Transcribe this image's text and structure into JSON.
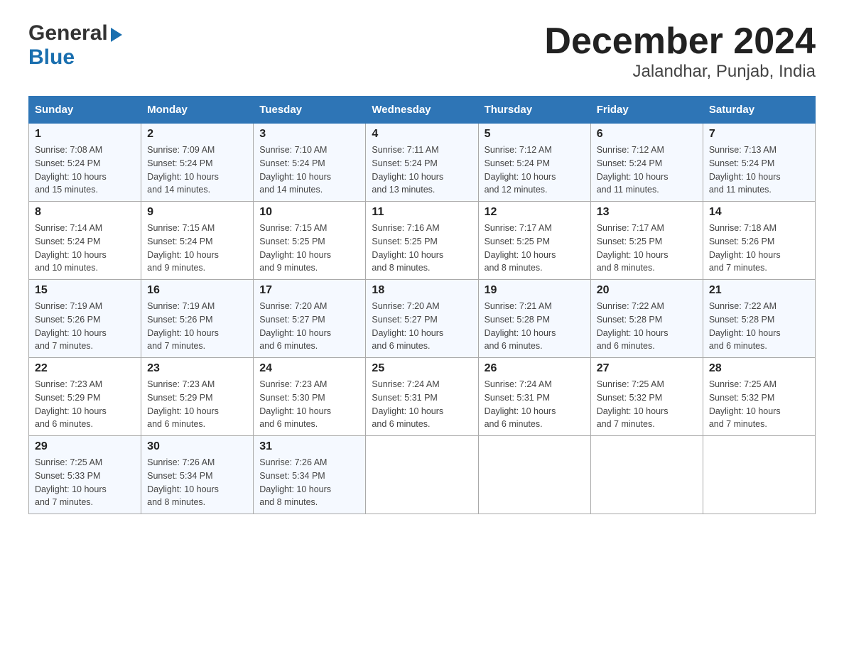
{
  "header": {
    "logo_general": "General",
    "logo_blue": "Blue",
    "title": "December 2024",
    "subtitle": "Jalandhar, Punjab, India"
  },
  "days_of_week": [
    "Sunday",
    "Monday",
    "Tuesday",
    "Wednesday",
    "Thursday",
    "Friday",
    "Saturday"
  ],
  "weeks": [
    [
      {
        "day": "1",
        "sunrise": "7:08 AM",
        "sunset": "5:24 PM",
        "daylight": "10 hours and 15 minutes."
      },
      {
        "day": "2",
        "sunrise": "7:09 AM",
        "sunset": "5:24 PM",
        "daylight": "10 hours and 14 minutes."
      },
      {
        "day": "3",
        "sunrise": "7:10 AM",
        "sunset": "5:24 PM",
        "daylight": "10 hours and 14 minutes."
      },
      {
        "day": "4",
        "sunrise": "7:11 AM",
        "sunset": "5:24 PM",
        "daylight": "10 hours and 13 minutes."
      },
      {
        "day": "5",
        "sunrise": "7:12 AM",
        "sunset": "5:24 PM",
        "daylight": "10 hours and 12 minutes."
      },
      {
        "day": "6",
        "sunrise": "7:12 AM",
        "sunset": "5:24 PM",
        "daylight": "10 hours and 11 minutes."
      },
      {
        "day": "7",
        "sunrise": "7:13 AM",
        "sunset": "5:24 PM",
        "daylight": "10 hours and 11 minutes."
      }
    ],
    [
      {
        "day": "8",
        "sunrise": "7:14 AM",
        "sunset": "5:24 PM",
        "daylight": "10 hours and 10 minutes."
      },
      {
        "day": "9",
        "sunrise": "7:15 AM",
        "sunset": "5:24 PM",
        "daylight": "10 hours and 9 minutes."
      },
      {
        "day": "10",
        "sunrise": "7:15 AM",
        "sunset": "5:25 PM",
        "daylight": "10 hours and 9 minutes."
      },
      {
        "day": "11",
        "sunrise": "7:16 AM",
        "sunset": "5:25 PM",
        "daylight": "10 hours and 8 minutes."
      },
      {
        "day": "12",
        "sunrise": "7:17 AM",
        "sunset": "5:25 PM",
        "daylight": "10 hours and 8 minutes."
      },
      {
        "day": "13",
        "sunrise": "7:17 AM",
        "sunset": "5:25 PM",
        "daylight": "10 hours and 8 minutes."
      },
      {
        "day": "14",
        "sunrise": "7:18 AM",
        "sunset": "5:26 PM",
        "daylight": "10 hours and 7 minutes."
      }
    ],
    [
      {
        "day": "15",
        "sunrise": "7:19 AM",
        "sunset": "5:26 PM",
        "daylight": "10 hours and 7 minutes."
      },
      {
        "day": "16",
        "sunrise": "7:19 AM",
        "sunset": "5:26 PM",
        "daylight": "10 hours and 7 minutes."
      },
      {
        "day": "17",
        "sunrise": "7:20 AM",
        "sunset": "5:27 PM",
        "daylight": "10 hours and 6 minutes."
      },
      {
        "day": "18",
        "sunrise": "7:20 AM",
        "sunset": "5:27 PM",
        "daylight": "10 hours and 6 minutes."
      },
      {
        "day": "19",
        "sunrise": "7:21 AM",
        "sunset": "5:28 PM",
        "daylight": "10 hours and 6 minutes."
      },
      {
        "day": "20",
        "sunrise": "7:22 AM",
        "sunset": "5:28 PM",
        "daylight": "10 hours and 6 minutes."
      },
      {
        "day": "21",
        "sunrise": "7:22 AM",
        "sunset": "5:28 PM",
        "daylight": "10 hours and 6 minutes."
      }
    ],
    [
      {
        "day": "22",
        "sunrise": "7:23 AM",
        "sunset": "5:29 PM",
        "daylight": "10 hours and 6 minutes."
      },
      {
        "day": "23",
        "sunrise": "7:23 AM",
        "sunset": "5:29 PM",
        "daylight": "10 hours and 6 minutes."
      },
      {
        "day": "24",
        "sunrise": "7:23 AM",
        "sunset": "5:30 PM",
        "daylight": "10 hours and 6 minutes."
      },
      {
        "day": "25",
        "sunrise": "7:24 AM",
        "sunset": "5:31 PM",
        "daylight": "10 hours and 6 minutes."
      },
      {
        "day": "26",
        "sunrise": "7:24 AM",
        "sunset": "5:31 PM",
        "daylight": "10 hours and 6 minutes."
      },
      {
        "day": "27",
        "sunrise": "7:25 AM",
        "sunset": "5:32 PM",
        "daylight": "10 hours and 7 minutes."
      },
      {
        "day": "28",
        "sunrise": "7:25 AM",
        "sunset": "5:32 PM",
        "daylight": "10 hours and 7 minutes."
      }
    ],
    [
      {
        "day": "29",
        "sunrise": "7:25 AM",
        "sunset": "5:33 PM",
        "daylight": "10 hours and 7 minutes."
      },
      {
        "day": "30",
        "sunrise": "7:26 AM",
        "sunset": "5:34 PM",
        "daylight": "10 hours and 8 minutes."
      },
      {
        "day": "31",
        "sunrise": "7:26 AM",
        "sunset": "5:34 PM",
        "daylight": "10 hours and 8 minutes."
      },
      null,
      null,
      null,
      null
    ]
  ],
  "labels": {
    "sunrise": "Sunrise:",
    "sunset": "Sunset:",
    "daylight": "Daylight:"
  }
}
